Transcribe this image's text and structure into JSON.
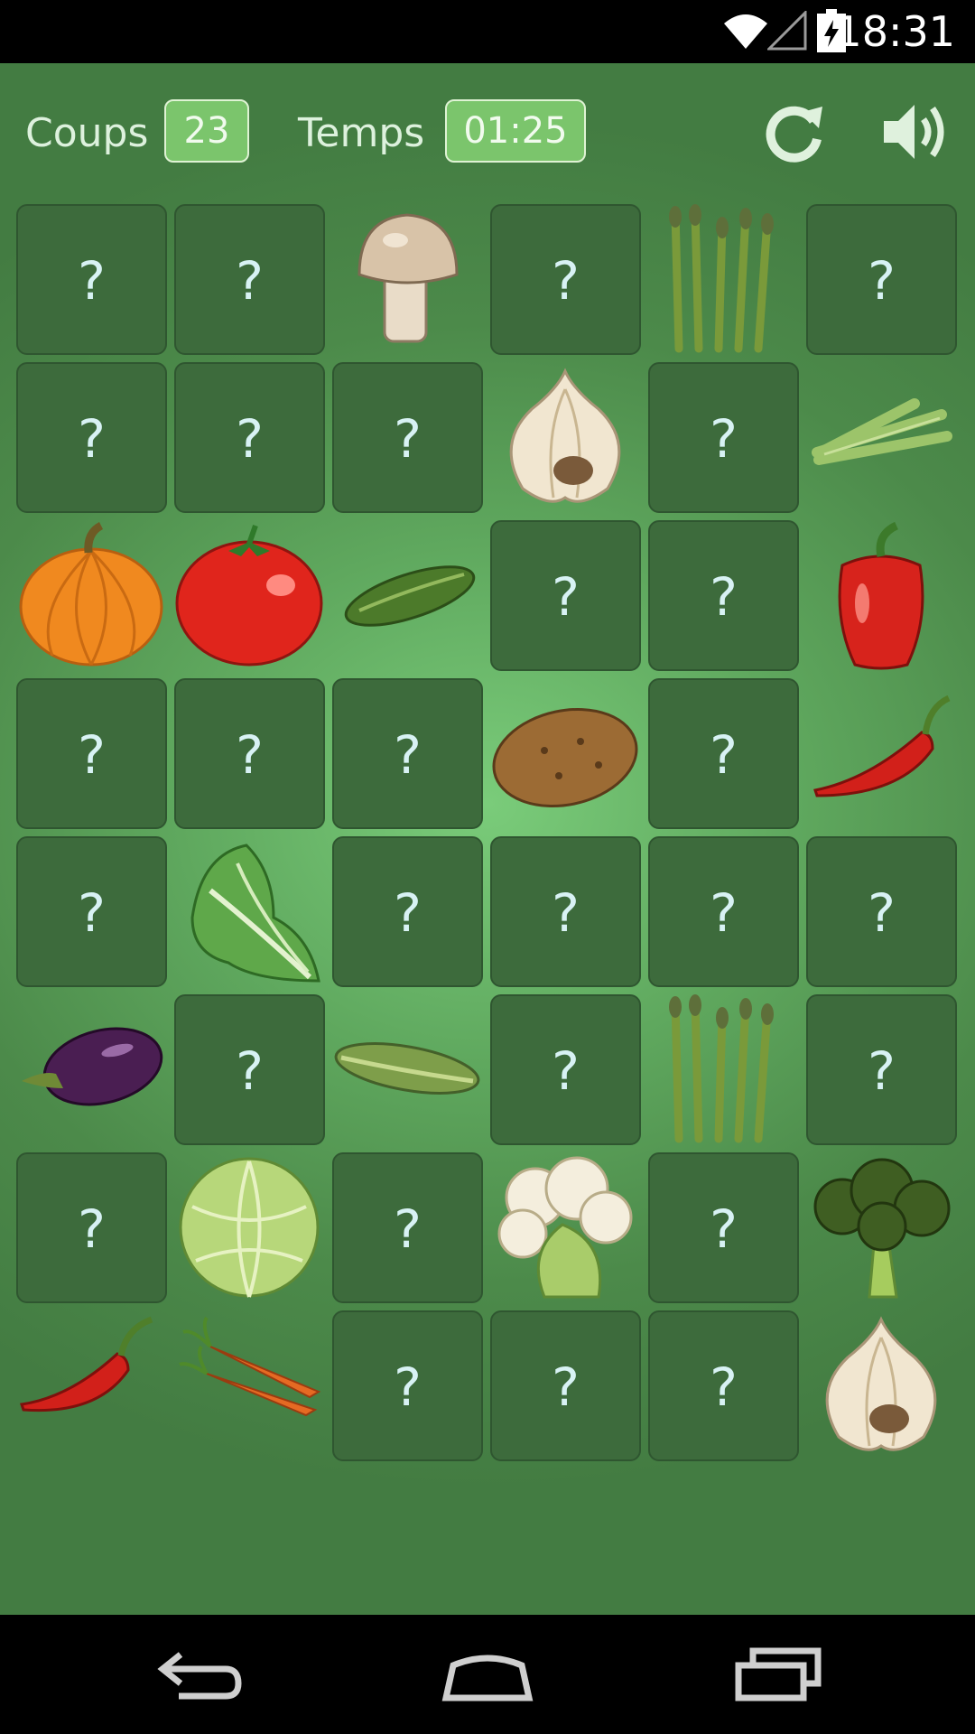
{
  "status": {
    "time": "18:31"
  },
  "hud": {
    "moves_label": "Coups",
    "moves_value": "23",
    "time_label": "Temps",
    "time_value": "01:25"
  },
  "board": {
    "hidden_symbol": "?",
    "columns": 6,
    "rows": 8,
    "cells": [
      [
        "?",
        "?",
        "mushroom",
        "?",
        "asparagus",
        "?"
      ],
      [
        "?",
        "?",
        "?",
        "garlic",
        "?",
        "celery"
      ],
      [
        "pumpkin",
        "tomato",
        "cucumber",
        "?",
        "?",
        "red-pepper"
      ],
      [
        "?",
        "?",
        "?",
        "potato",
        "?",
        "chili-pepper"
      ],
      [
        "?",
        "lettuce",
        "?",
        "?",
        "?",
        "?"
      ],
      [
        "eggplant",
        "?",
        "zucchini",
        "?",
        "asparagus",
        "?"
      ],
      [
        "?",
        "cabbage",
        "?",
        "cauliflower",
        "?",
        "broccoli"
      ],
      [
        "chili-pepper",
        "carrots",
        "?",
        "?",
        "?",
        "garlic"
      ]
    ]
  },
  "icons": {
    "restart": "refresh-icon",
    "sound": "speaker-icon",
    "nav": [
      "back-icon",
      "home-icon",
      "recents-icon"
    ]
  },
  "colors": {
    "card_back": "#3d6b3c",
    "hud_box": "#7bc56c"
  }
}
